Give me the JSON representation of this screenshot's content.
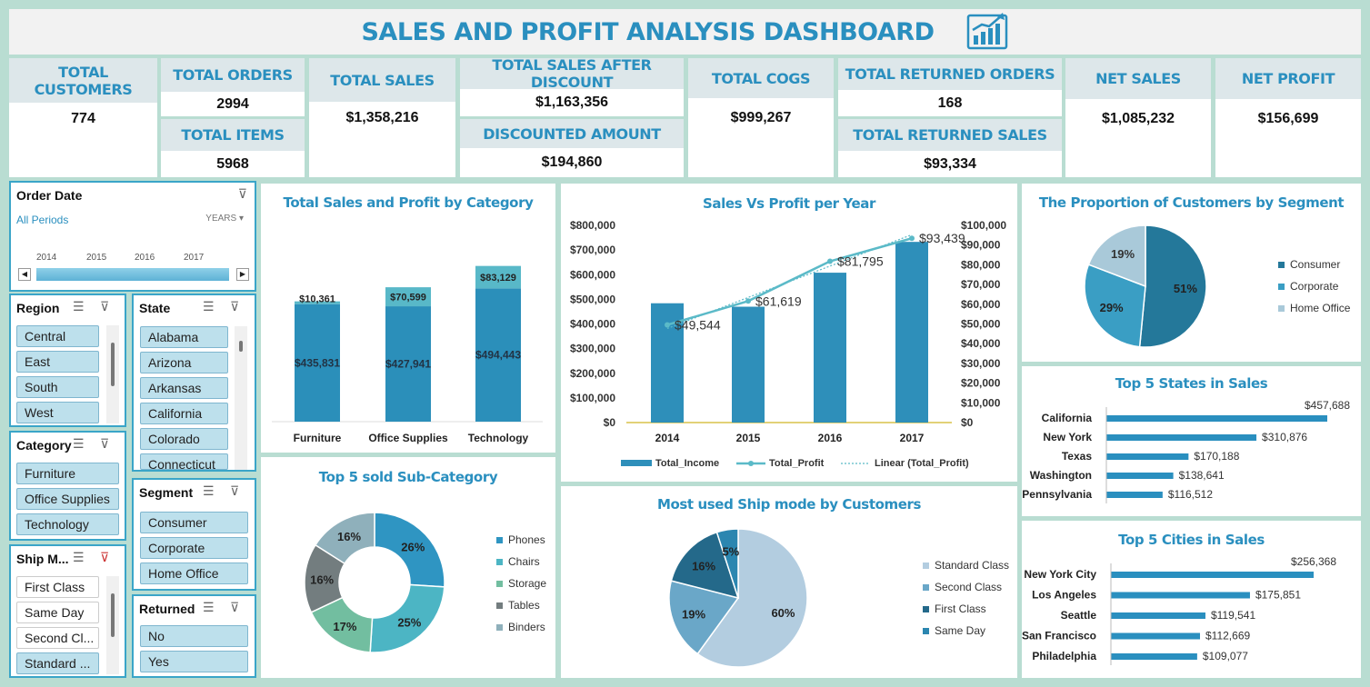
{
  "header": {
    "title": "SALES AND PROFIT ANALYSIS DASHBOARD"
  },
  "kpis": {
    "total_customers": {
      "label": "TOTAL CUSTOMERS",
      "value": "774"
    },
    "total_orders": {
      "label": "TOTAL ORDERS",
      "value": "2994"
    },
    "total_items": {
      "label": "TOTAL ITEMS",
      "value": "5968"
    },
    "total_sales": {
      "label": "TOTAL SALES",
      "value": "$1,358,216"
    },
    "sales_after_discount": {
      "label": "TOTAL SALES AFTER DISCOUNT",
      "value": "$1,163,356"
    },
    "discounted_amount": {
      "label": "DISCOUNTED AMOUNT",
      "value": "$194,860"
    },
    "total_cogs": {
      "label": "TOTAL COGS",
      "value": "$999,267"
    },
    "returned_orders": {
      "label": "TOTAL RETURNED ORDERS",
      "value": "168"
    },
    "returned_sales": {
      "label": "TOTAL RETURNED SALES",
      "value": "$93,334"
    },
    "net_sales": {
      "label": "NET SALES",
      "value": "$1,085,232"
    },
    "net_profit": {
      "label": "NET PROFIT",
      "value": "$156,699"
    }
  },
  "timeline": {
    "label": "Order Date",
    "period": "All Periods",
    "unit": "YEARS",
    "years": [
      "2014",
      "2015",
      "2016",
      "2017"
    ]
  },
  "slicers": {
    "region": {
      "label": "Region",
      "items": [
        "Central",
        "East",
        "South",
        "West"
      ]
    },
    "state": {
      "label": "State",
      "items": [
        "Alabama",
        "Arizona",
        "Arkansas",
        "California",
        "Colorado",
        "Connecticut"
      ]
    },
    "category": {
      "label": "Category",
      "items": [
        "Furniture",
        "Office Supplies",
        "Technology"
      ]
    },
    "segment": {
      "label": "Segment",
      "items": [
        "Consumer",
        "Corporate",
        "Home Office"
      ]
    },
    "ship_mode": {
      "label": "Ship M...",
      "items": [
        "First Class",
        "Same Day",
        "Second Cl...",
        "Standard ..."
      ]
    },
    "returned": {
      "label": "Returned",
      "items": [
        "No",
        "Yes"
      ]
    }
  },
  "chart_data": [
    {
      "id": "category",
      "type": "bar",
      "title": "Total Sales and Profit by Category",
      "categories": [
        "Furniture",
        "Office Supplies",
        "Technology"
      ],
      "series": [
        {
          "name": "Sales",
          "values": [
            435831,
            427941,
            494443
          ],
          "labels": [
            "$435,831",
            "$427,941",
            "$494,443"
          ]
        },
        {
          "name": "Profit",
          "values": [
            10361,
            70599,
            83129
          ],
          "labels": [
            "$10,361",
            "$70,599",
            "$83,129"
          ]
        }
      ],
      "colors": {
        "sales": "#2b8fba",
        "profit": "#58b8c8"
      }
    },
    {
      "id": "year",
      "type": "bar",
      "title": "Sales Vs Profit per Year",
      "categories": [
        "2014",
        "2015",
        "2016",
        "2017"
      ],
      "series": [
        {
          "name": "Total_Income",
          "values": [
            484000,
            470000,
            608000,
            733000
          ]
        },
        {
          "name": "Total_Profit",
          "values": [
            49544,
            61619,
            81795,
            93439
          ],
          "labels": [
            "$49,544",
            "$61,619",
            "$81,795",
            "$93,439"
          ]
        },
        {
          "name": "Linear (Total_Profit)"
        }
      ],
      "y_left_ticks": [
        "$800,000",
        "$700,000",
        "$600,000",
        "$500,000",
        "$400,000",
        "$300,000",
        "$200,000",
        "$100,000",
        "$0"
      ],
      "y_right_ticks": [
        "$100,000",
        "$90,000",
        "$80,000",
        "$70,000",
        "$60,000",
        "$50,000",
        "$40,000",
        "$30,000",
        "$20,000",
        "$10,000",
        "$0"
      ],
      "ylim_left": [
        0,
        800000
      ],
      "ylim_right": [
        0,
        100000
      ]
    },
    {
      "id": "segment",
      "type": "pie",
      "title": "The Proportion of Customers by Segment",
      "labels": [
        "Consumer",
        "Corporate",
        "Home Office"
      ],
      "values": [
        51,
        29,
        19
      ],
      "value_labels": [
        "51%",
        "29%",
        "19%"
      ],
      "colors": [
        "#24789a",
        "#3a9ec4",
        "#a9c9d9"
      ]
    },
    {
      "id": "subcategory",
      "type": "pie",
      "title": "Top 5 sold Sub-Category",
      "labels": [
        "Phones",
        "Chairs",
        "Storage",
        "Tables",
        "Binders"
      ],
      "values": [
        26,
        25,
        17,
        16,
        16
      ],
      "value_labels": [
        "26%",
        "25%",
        "17%",
        "16%",
        "16%"
      ],
      "colors": [
        "#2f95c2",
        "#4cb5c4",
        "#72bea0",
        "#737d7f",
        "#8fb0bb"
      ]
    },
    {
      "id": "shipmode",
      "type": "pie",
      "title": "Most used Ship mode by Customers",
      "labels": [
        "Standard Class",
        "Second Class",
        "First Class",
        "Same Day"
      ],
      "values": [
        60,
        19,
        16,
        5
      ],
      "value_labels": [
        "60%",
        "19%",
        "16%",
        "5%"
      ],
      "colors": [
        "#b3cde0",
        "#6aa7c8",
        "#24698a",
        "#2b86b0"
      ]
    },
    {
      "id": "states",
      "type": "bar",
      "title": "Top 5 States in Sales",
      "categories": [
        "California",
        "New York",
        "Texas",
        "Washington",
        "Pennsylvania"
      ],
      "values": [
        457688,
        310876,
        170188,
        138641,
        116512
      ],
      "value_labels": [
        "$457,688",
        "$310,876",
        "$170,188",
        "$138,641",
        "$116,512"
      ]
    },
    {
      "id": "cities",
      "type": "bar",
      "title": "Top 5 Cities in Sales",
      "categories": [
        "New York City",
        "Los Angeles",
        "Seattle",
        "San Francisco",
        "Philadelphia"
      ],
      "values": [
        256368,
        175851,
        119541,
        112669,
        109077
      ],
      "value_labels": [
        "$256,368",
        "$175,851",
        "$119,541",
        "$112,669",
        "$109,077"
      ]
    }
  ]
}
